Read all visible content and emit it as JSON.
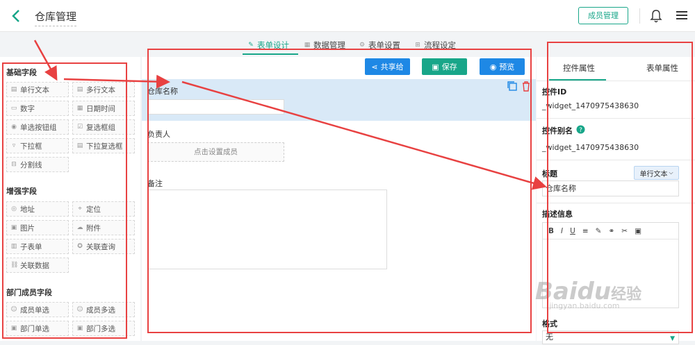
{
  "header": {
    "title": "仓库管理",
    "member_button": "成员管理"
  },
  "tabs": [
    {
      "label": "表单设计",
      "icon": "form-design-icon",
      "active": true
    },
    {
      "label": "数据管理",
      "icon": "grid-icon"
    },
    {
      "label": "表单设置",
      "icon": "gear-icon"
    },
    {
      "label": "流程设定",
      "icon": "flow-icon"
    }
  ],
  "left": {
    "groups": [
      {
        "title": "基础字段",
        "items": [
          "单行文本",
          "多行文本",
          "数字",
          "日期时间",
          "单选按钮组",
          "复选框组",
          "下拉框",
          "下拉复选框",
          "分割线"
        ]
      },
      {
        "title": "增强字段",
        "items": [
          "地址",
          "定位",
          "图片",
          "附件",
          "子表单",
          "关联查询",
          "关联数据"
        ]
      },
      {
        "title": "部门成员字段",
        "items": [
          "成员单选",
          "成员多选",
          "部门单选",
          "部门多选"
        ]
      }
    ]
  },
  "canvas": {
    "share_button": "共享给",
    "save_button": "保存",
    "preview_button": "预览",
    "fields": [
      {
        "label": "仓库名称"
      },
      {
        "label": "负责人",
        "placeholder": "点击设置成员"
      },
      {
        "label": "备注"
      }
    ]
  },
  "right": {
    "tabs": [
      "控件属性",
      "表单属性"
    ],
    "widget_id_label": "控件ID",
    "widget_id": "_widget_1470975438630",
    "widget_alias_label": "控件别名",
    "widget_alias": "_widget_1470975438630",
    "title_label": "标题",
    "type_select": "单行文本",
    "title_value": "仓库名称",
    "desc_label": "描述信息",
    "toolbar": [
      "B",
      "I",
      "U"
    ],
    "format_label": "格式",
    "format_value": "无"
  },
  "watermark": {
    "line1": "Bai",
    "line2": "du",
    "line3": "经验",
    "line4": "jingyan.baidu.com"
  },
  "colors": {
    "accent": "#18a689",
    "primary": "#1e88e5",
    "annotation": "#e84141"
  }
}
